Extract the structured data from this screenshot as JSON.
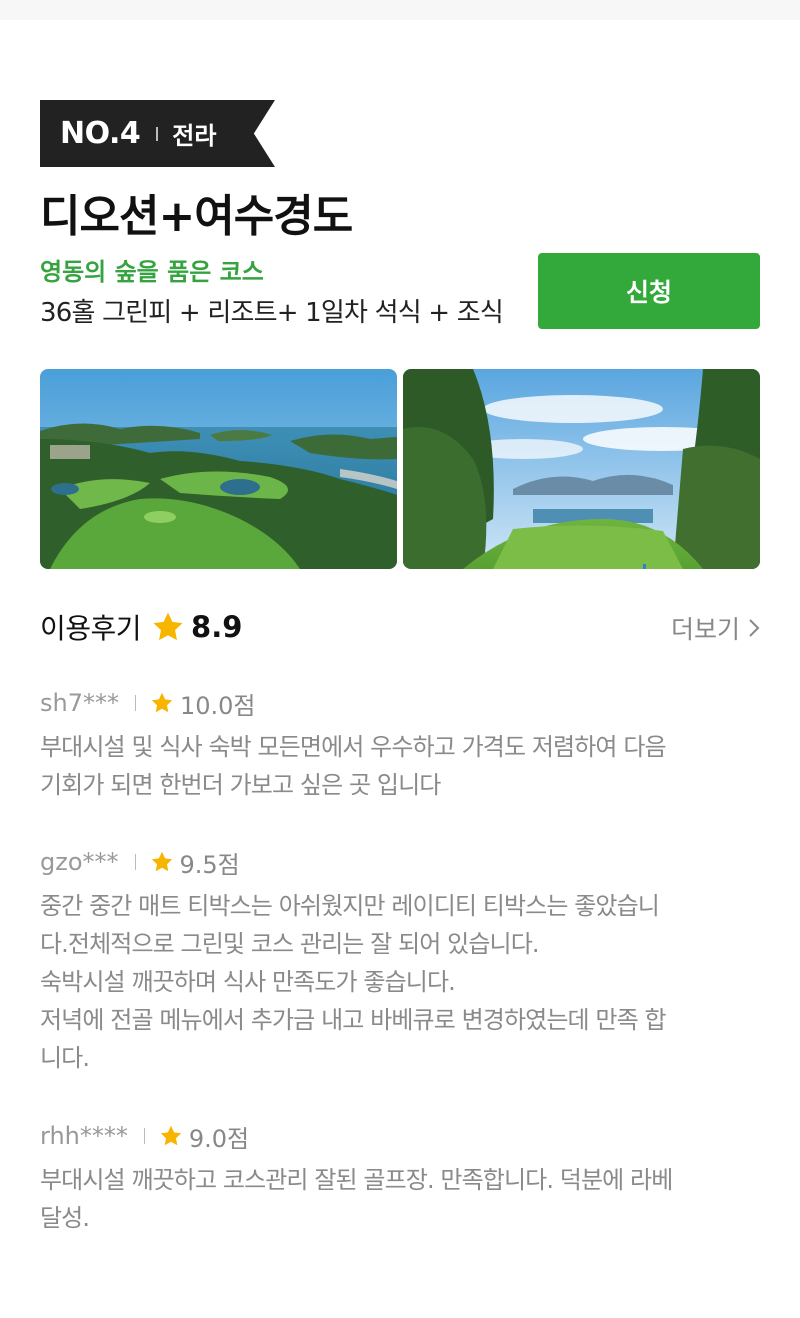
{
  "rank": {
    "number": "NO.4",
    "region": "전라"
  },
  "course": {
    "title": "디오션+여수경도",
    "tagline": "영동의 숲을 품은 코스",
    "package": "36홀 그린피 + 리조트+ 1일차 석식 + 조식"
  },
  "apply_button_label": "신청",
  "reviews_section": {
    "title": "이용후기",
    "average": "8.9",
    "more_label": "더보기"
  },
  "reviews": [
    {
      "user": "sh7***",
      "score": "10.0점",
      "text": "부대시설 및 식사 숙박 모든면에서 우수하고 가격도 저렴하여 다음\n기회가 되면 한번더 가보고 싶은 곳 입니다"
    },
    {
      "user": "gzo***",
      "score": "9.5점",
      "text": "중간 중간 매트 티박스는 아쉬웠지만 레이디티 티박스는 좋았습니\n다.전체적으로 그린및 코스 관리는 잘 되어 있습니다.\n숙박시설 깨끗하며 식사 만족도가 좋습니다.\n저녁에 전골 메뉴에서 추가금 내고 바베큐로 변경하였는데 만족 합\n니다."
    },
    {
      "user": "rhh****",
      "score": "9.0점",
      "text": "부대시설 깨끗하고 코스관리 잘된 골프장. 만족합니다. 덕분에 라베\n달성."
    }
  ],
  "colors": {
    "accent_green": "#34a93b",
    "tagline_green": "#35a33f",
    "star_yellow": "#f7b500",
    "banner_dark": "#222222"
  },
  "icons": {
    "rating": "star-icon",
    "more": "chevron-right-icon"
  }
}
